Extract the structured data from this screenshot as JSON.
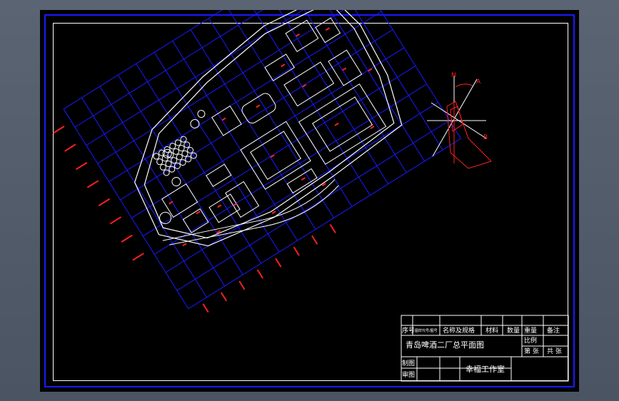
{
  "title_block": {
    "seq_no": "序号",
    "code": "图样代号/图号",
    "name_spec": "名称及规格",
    "material": "材料",
    "quantity": "数量",
    "weight": "重量",
    "remark": "备注",
    "scale": "比例",
    "drawing_title": "青岛啤酒二厂总平面图",
    "sheet": "第 张",
    "total": "共 张",
    "drawn_by": "制图",
    "checked_by": "审图",
    "studio": "幸福工作室"
  },
  "compass": {
    "north": "N",
    "label_a": "A",
    "label_b": "B"
  },
  "colors": {
    "background": "#000000",
    "grid": "#1a1aff",
    "linework": "#ffffff",
    "annotation": "#ff2020",
    "frame": "#1a1aff"
  }
}
